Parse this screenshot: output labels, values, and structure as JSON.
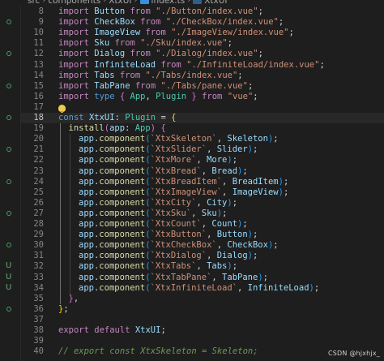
{
  "breadcrumb": [
    "src",
    "components",
    "XtxUI",
    "index.ts",
    "XtxUI"
  ],
  "lines": [
    {
      "n": "8",
      "tokens": [
        [
          "kw",
          "import "
        ],
        [
          "var",
          "Button"
        ],
        [
          "kw",
          " from "
        ],
        [
          "str",
          "\"./Button/index.vue\""
        ],
        [
          "punc",
          ";"
        ]
      ]
    },
    {
      "n": "9",
      "tokens": [
        [
          "kw",
          "import "
        ],
        [
          "var",
          "CheckBox"
        ],
        [
          "kw",
          " from "
        ],
        [
          "str",
          "\"./CheckBox/index.vue\""
        ],
        [
          "punc",
          ";"
        ]
      ]
    },
    {
      "n": "10",
      "tokens": [
        [
          "kw",
          "import "
        ],
        [
          "var",
          "ImageView"
        ],
        [
          "kw",
          " from "
        ],
        [
          "str",
          "\"./ImageView/index.vue\""
        ],
        [
          "punc",
          ";"
        ]
      ]
    },
    {
      "n": "11",
      "tokens": [
        [
          "kw",
          "import "
        ],
        [
          "var",
          "Sku"
        ],
        [
          "kw",
          " from "
        ],
        [
          "str",
          "\"./Sku/index.vue\""
        ],
        [
          "punc",
          ";"
        ]
      ]
    },
    {
      "n": "12",
      "tokens": [
        [
          "kw",
          "import "
        ],
        [
          "var",
          "Dialog"
        ],
        [
          "kw",
          " from "
        ],
        [
          "str",
          "\"./Dialog/index.vue\""
        ],
        [
          "punc",
          ";"
        ]
      ]
    },
    {
      "n": "13",
      "tokens": [
        [
          "kw",
          "import "
        ],
        [
          "var",
          "InfiniteLoad"
        ],
        [
          "kw",
          " from "
        ],
        [
          "str",
          "\"./InfiniteLoad/index.vue\""
        ],
        [
          "punc",
          ";"
        ]
      ]
    },
    {
      "n": "14",
      "tokens": [
        [
          "kw",
          "import "
        ],
        [
          "var",
          "Tabs"
        ],
        [
          "kw",
          " from "
        ],
        [
          "str",
          "\"./Tabs/index.vue\""
        ],
        [
          "punc",
          ";"
        ]
      ]
    },
    {
      "n": "15",
      "tokens": [
        [
          "kw",
          "import "
        ],
        [
          "var",
          "TabPane"
        ],
        [
          "kw",
          " from "
        ],
        [
          "str",
          "\"./Tabs/pane.vue\""
        ],
        [
          "punc",
          ";"
        ]
      ]
    },
    {
      "n": "16",
      "tokens": [
        [
          "kw",
          "import "
        ],
        [
          "kb",
          "type "
        ],
        [
          "brace",
          "{ "
        ],
        [
          "cls",
          "App"
        ],
        [
          "punc",
          ", "
        ],
        [
          "cls",
          "Plugin"
        ],
        [
          "brace",
          " }"
        ],
        [
          "kw",
          " from "
        ],
        [
          "str",
          "\"vue\""
        ],
        [
          "punc",
          ";"
        ]
      ]
    },
    {
      "n": "17",
      "tokens": []
    },
    {
      "n": "18",
      "tokens": [
        [
          "kb",
          "const "
        ],
        [
          "var",
          "XtxUI"
        ],
        [
          "punc",
          ": "
        ],
        [
          "cls",
          "Plugin"
        ],
        [
          "punc",
          " = "
        ],
        [
          "bracket",
          "{"
        ]
      ]
    },
    {
      "n": "19",
      "tokens": [
        [
          "fn",
          "install"
        ],
        [
          "brace",
          "("
        ],
        [
          "var",
          "app"
        ],
        [
          "punc",
          ": "
        ],
        [
          "cls",
          "App"
        ],
        [
          "brace",
          ")"
        ],
        [
          "punc",
          " "
        ],
        [
          "brace",
          "{"
        ]
      ]
    },
    {
      "n": "20",
      "tokens": [
        [
          "var",
          "app"
        ],
        [
          "punc",
          "."
        ],
        [
          "fn",
          "component"
        ],
        [
          "brace2",
          "("
        ],
        [
          "str",
          "`XtxSkeleton`"
        ],
        [
          "punc",
          ", "
        ],
        [
          "var",
          "Skeleton"
        ],
        [
          "brace2",
          ")"
        ],
        [
          "punc",
          ";"
        ]
      ]
    },
    {
      "n": "21",
      "tokens": [
        [
          "var",
          "app"
        ],
        [
          "punc",
          "."
        ],
        [
          "fn",
          "component"
        ],
        [
          "brace2",
          "("
        ],
        [
          "str",
          "`XtxSlider`"
        ],
        [
          "punc",
          ", "
        ],
        [
          "var",
          "Slider"
        ],
        [
          "brace2",
          ")"
        ],
        [
          "punc",
          ";"
        ]
      ]
    },
    {
      "n": "22",
      "tokens": [
        [
          "var",
          "app"
        ],
        [
          "punc",
          "."
        ],
        [
          "fn",
          "component"
        ],
        [
          "brace2",
          "("
        ],
        [
          "str",
          "`XtxMore`"
        ],
        [
          "punc",
          ", "
        ],
        [
          "var",
          "More"
        ],
        [
          "brace2",
          ")"
        ],
        [
          "punc",
          ";"
        ]
      ]
    },
    {
      "n": "23",
      "tokens": [
        [
          "var",
          "app"
        ],
        [
          "punc",
          "."
        ],
        [
          "fn",
          "component"
        ],
        [
          "brace2",
          "("
        ],
        [
          "str",
          "`XtxBread`"
        ],
        [
          "punc",
          ", "
        ],
        [
          "var",
          "Bread"
        ],
        [
          "brace2",
          ")"
        ],
        [
          "punc",
          ";"
        ]
      ]
    },
    {
      "n": "24",
      "tokens": [
        [
          "var",
          "app"
        ],
        [
          "punc",
          "."
        ],
        [
          "fn",
          "component"
        ],
        [
          "brace2",
          "("
        ],
        [
          "str",
          "`XtxBreadItem`"
        ],
        [
          "punc",
          ", "
        ],
        [
          "var",
          "BreadItem"
        ],
        [
          "brace2",
          ")"
        ],
        [
          "punc",
          ";"
        ]
      ]
    },
    {
      "n": "25",
      "tokens": [
        [
          "var",
          "app"
        ],
        [
          "punc",
          "."
        ],
        [
          "fn",
          "component"
        ],
        [
          "brace2",
          "("
        ],
        [
          "str",
          "`XtxImageView`"
        ],
        [
          "punc",
          ", "
        ],
        [
          "var",
          "ImageView"
        ],
        [
          "brace2",
          ")"
        ],
        [
          "punc",
          ";"
        ]
      ]
    },
    {
      "n": "26",
      "tokens": [
        [
          "var",
          "app"
        ],
        [
          "punc",
          "."
        ],
        [
          "fn",
          "component"
        ],
        [
          "brace2",
          "("
        ],
        [
          "str",
          "`XtxCity`"
        ],
        [
          "punc",
          ", "
        ],
        [
          "var",
          "City"
        ],
        [
          "brace2",
          ")"
        ],
        [
          "punc",
          ";"
        ]
      ]
    },
    {
      "n": "27",
      "tokens": [
        [
          "var",
          "app"
        ],
        [
          "punc",
          "."
        ],
        [
          "fn",
          "component"
        ],
        [
          "brace2",
          "("
        ],
        [
          "str",
          "`XtxSku`"
        ],
        [
          "punc",
          ", "
        ],
        [
          "var",
          "Sku"
        ],
        [
          "brace2",
          ")"
        ],
        [
          "punc",
          ";"
        ]
      ]
    },
    {
      "n": "28",
      "tokens": [
        [
          "var",
          "app"
        ],
        [
          "punc",
          "."
        ],
        [
          "fn",
          "component"
        ],
        [
          "brace2",
          "("
        ],
        [
          "str",
          "`XtxCount`"
        ],
        [
          "punc",
          ", "
        ],
        [
          "var",
          "Count"
        ],
        [
          "brace2",
          ")"
        ],
        [
          "punc",
          ";"
        ]
      ]
    },
    {
      "n": "29",
      "tokens": [
        [
          "var",
          "app"
        ],
        [
          "punc",
          "."
        ],
        [
          "fn",
          "component"
        ],
        [
          "brace2",
          "("
        ],
        [
          "str",
          "`XtxButton`"
        ],
        [
          "punc",
          ", "
        ],
        [
          "var",
          "Button"
        ],
        [
          "brace2",
          ")"
        ],
        [
          "punc",
          ";"
        ]
      ]
    },
    {
      "n": "30",
      "tokens": [
        [
          "var",
          "app"
        ],
        [
          "punc",
          "."
        ],
        [
          "fn",
          "component"
        ],
        [
          "brace2",
          "("
        ],
        [
          "str",
          "`XtxCheckBox`"
        ],
        [
          "punc",
          ", "
        ],
        [
          "var",
          "CheckBox"
        ],
        [
          "brace2",
          ")"
        ],
        [
          "punc",
          ";"
        ]
      ]
    },
    {
      "n": "31",
      "tokens": [
        [
          "var",
          "app"
        ],
        [
          "punc",
          "."
        ],
        [
          "fn",
          "component"
        ],
        [
          "brace2",
          "("
        ],
        [
          "str",
          "`XtxDialog`"
        ],
        [
          "punc",
          ", "
        ],
        [
          "var",
          "Dialog"
        ],
        [
          "brace2",
          ")"
        ],
        [
          "punc",
          ";"
        ]
      ]
    },
    {
      "n": "32",
      "tokens": [
        [
          "var",
          "app"
        ],
        [
          "punc",
          "."
        ],
        [
          "fn",
          "component"
        ],
        [
          "brace2",
          "("
        ],
        [
          "str",
          "`XtxTabs`"
        ],
        [
          "punc",
          ", "
        ],
        [
          "var",
          "Tabs"
        ],
        [
          "brace2",
          ")"
        ],
        [
          "punc",
          ";"
        ]
      ]
    },
    {
      "n": "33",
      "tokens": [
        [
          "var",
          "app"
        ],
        [
          "punc",
          "."
        ],
        [
          "fn",
          "component"
        ],
        [
          "brace2",
          "("
        ],
        [
          "str",
          "`XtxTabPane`"
        ],
        [
          "punc",
          ", "
        ],
        [
          "var",
          "TabPane"
        ],
        [
          "brace2",
          ")"
        ],
        [
          "punc",
          ";"
        ]
      ]
    },
    {
      "n": "34",
      "tokens": [
        [
          "var",
          "app"
        ],
        [
          "punc",
          "."
        ],
        [
          "fn",
          "component"
        ],
        [
          "brace2",
          "("
        ],
        [
          "str",
          "`XtxInfiniteLoad`"
        ],
        [
          "punc",
          ", "
        ],
        [
          "var",
          "InfiniteLoad"
        ],
        [
          "brace2",
          ")"
        ],
        [
          "punc",
          ";"
        ]
      ]
    },
    {
      "n": "35",
      "tokens": [
        [
          "brace",
          "}"
        ],
        [
          "punc",
          ","
        ]
      ]
    },
    {
      "n": "36",
      "tokens": [
        [
          "bracket",
          "}"
        ],
        [
          "punc",
          ";"
        ]
      ]
    },
    {
      "n": "37",
      "tokens": []
    },
    {
      "n": "38",
      "tokens": [
        [
          "kw",
          "export "
        ],
        [
          "kw",
          "default "
        ],
        [
          "var",
          "XtxUI"
        ],
        [
          "punc",
          ";"
        ]
      ]
    },
    {
      "n": "39",
      "tokens": []
    },
    {
      "n": "40",
      "tokens": [
        [
          "comment",
          "// export const XtxSkeleton = Skeleton;"
        ]
      ]
    }
  ],
  "indents": {
    "19": 1,
    "20": 2,
    "21": 2,
    "22": 2,
    "23": 2,
    "24": 2,
    "25": 2,
    "26": 2,
    "27": 2,
    "28": 2,
    "29": 2,
    "30": 2,
    "31": 2,
    "32": 2,
    "33": 2,
    "34": 2,
    "35": 1
  },
  "active_line": "18",
  "lightbulb_line": "17",
  "side_markers": [
    {
      "type": "dot",
      "line_index": 1
    },
    {
      "type": "dot",
      "line_index": 4
    },
    {
      "type": "dot",
      "line_index": 7
    },
    {
      "type": "dot",
      "line_index": 10
    },
    {
      "type": "dot",
      "line_index": 13
    },
    {
      "type": "dot",
      "line_index": 16
    },
    {
      "type": "dot",
      "line_index": 19
    },
    {
      "type": "dot",
      "line_index": 22
    },
    {
      "type": "U",
      "line_index": 24
    },
    {
      "type": "U",
      "line_index": 25
    },
    {
      "type": "U",
      "line_index": 26
    },
    {
      "type": "dot",
      "line_index": 28
    }
  ],
  "watermark": "CSDN @hjxhjx_"
}
